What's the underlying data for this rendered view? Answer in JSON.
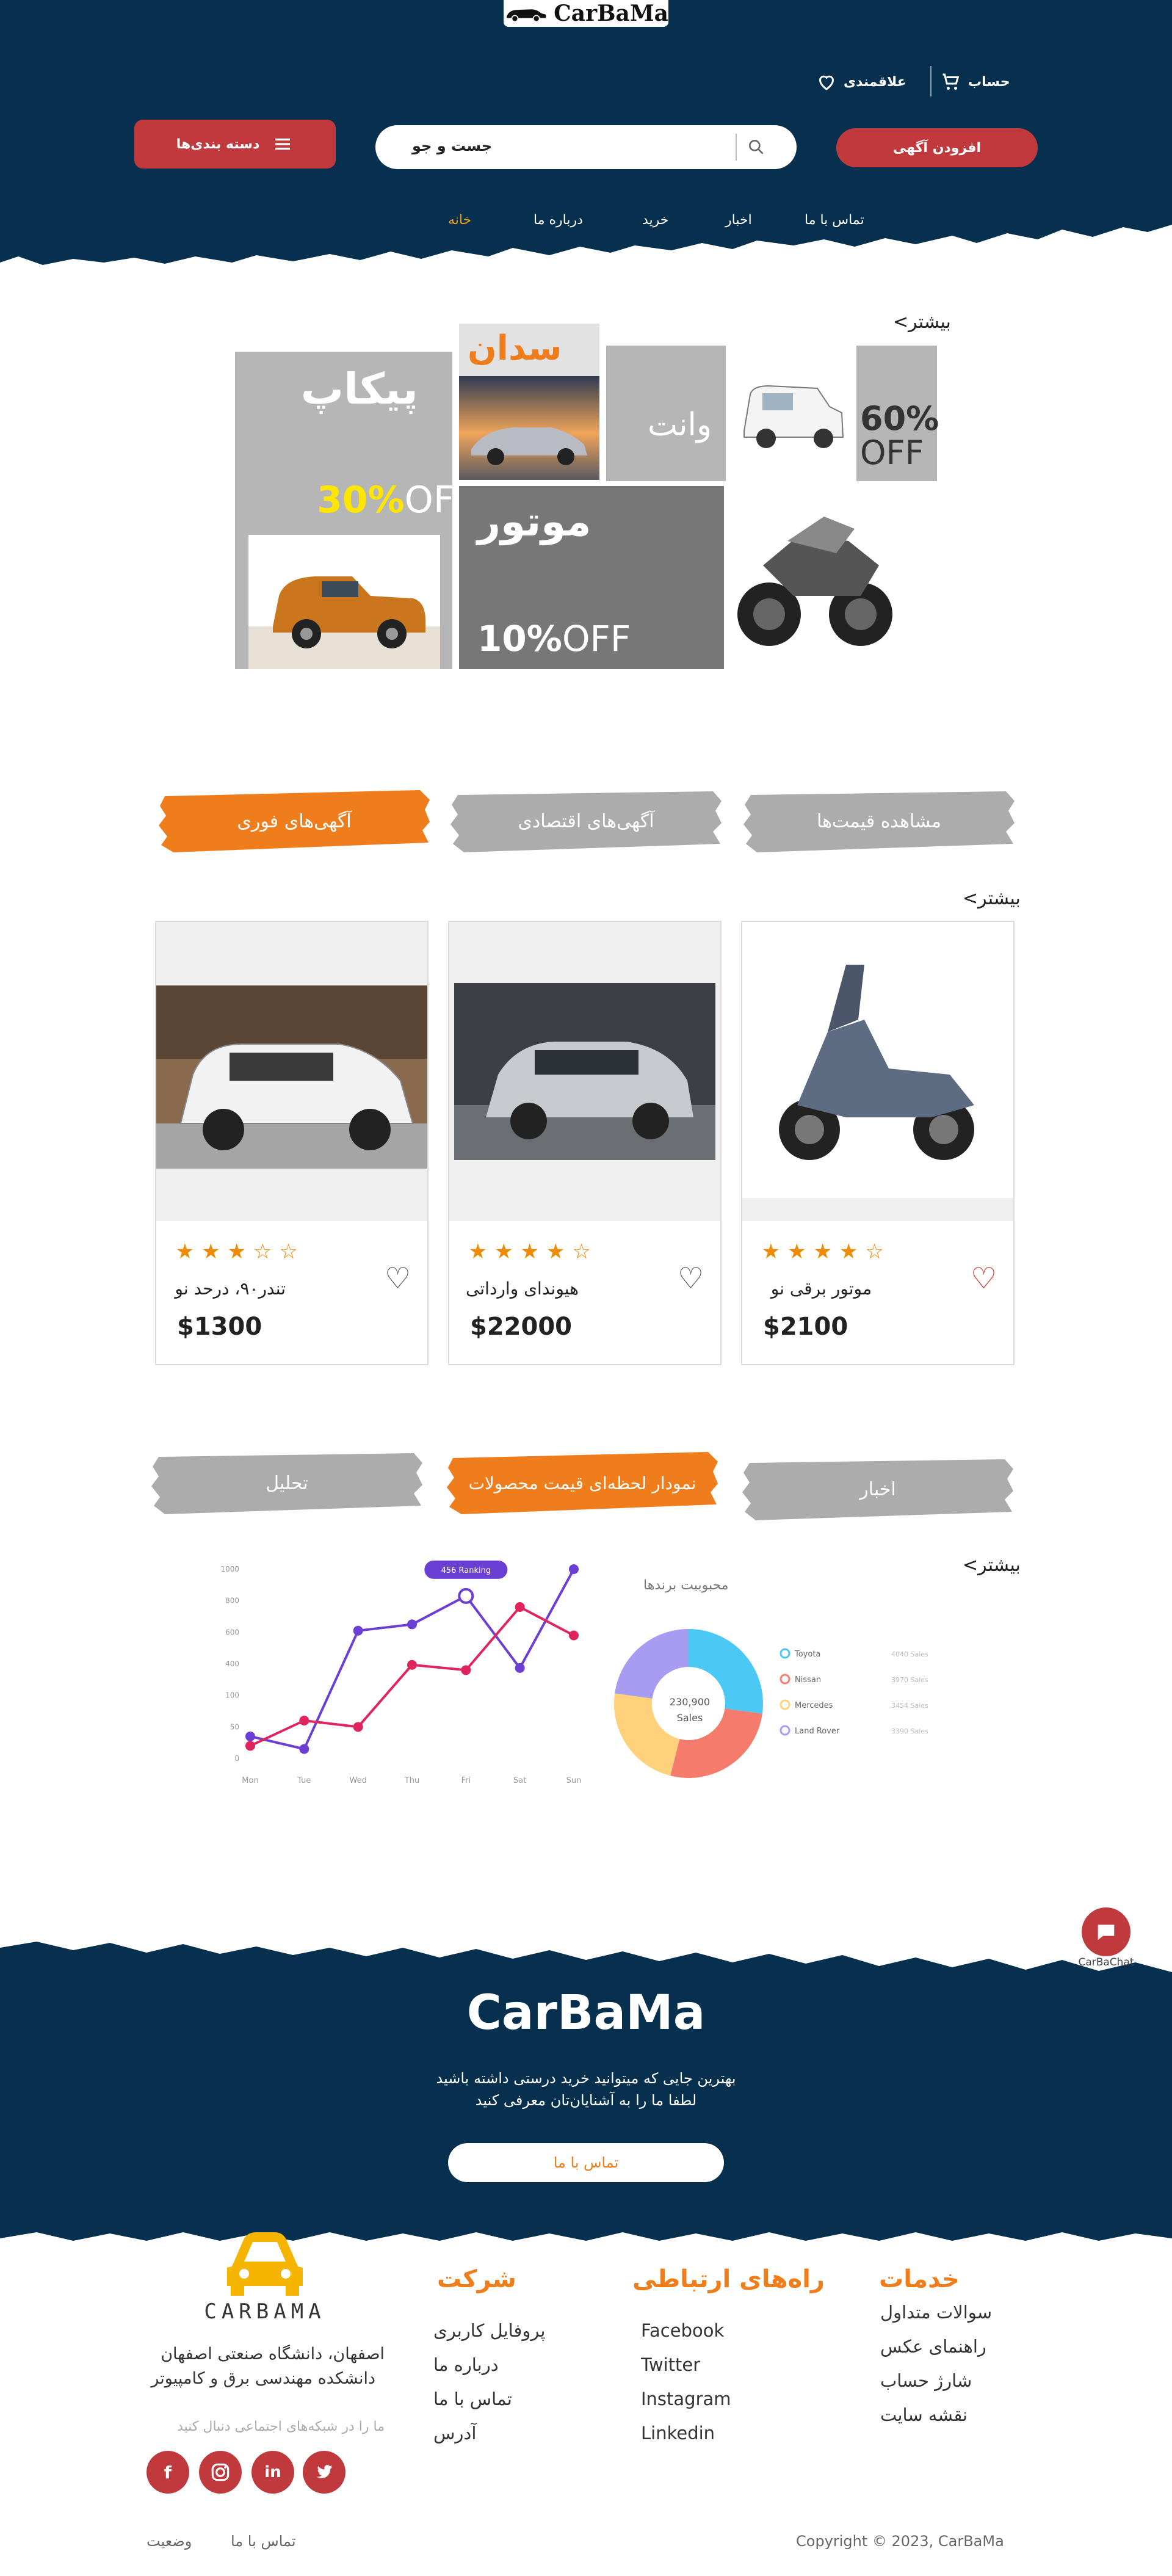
{
  "header": {
    "brand": "CarBaMa",
    "account_label": "حساب",
    "favorites_label": "علاقمندی",
    "add_ad_label": "افزودن آگهی",
    "search_placeholder": "جست و جو",
    "categories_label": "دسته بندی‌ها",
    "nav": [
      "خانه",
      "درباره ما",
      "خرید",
      "اخبار",
      "تماس با ما"
    ]
  },
  "banner": {
    "more": "<بیشتر",
    "pickup": {
      "title": "پیکاپ",
      "pct": "30%",
      "off": "OFF"
    },
    "sedan": {
      "title": "سدان"
    },
    "van": {
      "title": "وانت",
      "pct": "60%",
      "off": "OFF"
    },
    "motor": {
      "title": "موتور",
      "pct": "10%",
      "off": "OFF"
    }
  },
  "tabs1": [
    "آگهی‌های فوری",
    "آگهی‌های اقتصادی",
    "مشاهده قیمت‌ها"
  ],
  "products": {
    "more": "<بیشتر",
    "items": [
      {
        "name": "تندر۹۰، درحد نو",
        "price": "$1300",
        "rating": 3,
        "stars": "★★★☆☆",
        "favorite": false
      },
      {
        "name": "هیوندای وارداتی",
        "price": "$22000",
        "rating": 4,
        "stars": "★★★★☆",
        "favorite": false
      },
      {
        "name": "موتور برقی نو",
        "price": "$2100",
        "rating": 4,
        "stars": "★★★★☆",
        "favorite": true
      }
    ]
  },
  "tabs2": [
    "تحلیل",
    "نمودار لحظه‌ای قیمت محصولات",
    "اخبار"
  ],
  "analytics": {
    "more": "<بیشتر",
    "donut_title": "محبوبیت برندها",
    "donut_center_value": "230,900",
    "donut_center_label": "Sales"
  },
  "chart_data": [
    {
      "type": "line",
      "x": [
        "Mon",
        "Tue",
        "Wed",
        "Thu",
        "Fri",
        "Sat",
        "Sun"
      ],
      "yticks": [
        "1000",
        "800",
        "600",
        "400",
        "100",
        "50",
        "0"
      ],
      "series": [
        {
          "name": "",
          "color": "#6b3fd4",
          "values": [
            35,
            15,
            610,
            650,
            830,
            360,
            1000
          ]
        },
        {
          "name": "",
          "color": "#e0245e",
          "values": [
            20,
            60,
            50,
            390,
            340,
            760,
            580
          ]
        }
      ],
      "annotation": "456 Ranking",
      "annotation_point": "Fri"
    },
    {
      "type": "pie",
      "title": "محبوبیت برندها",
      "labels": [
        "Toyota",
        "Nissan",
        "Mercedes",
        "Land Rover"
      ],
      "values": [
        4040,
        3970,
        3454,
        3390
      ],
      "value_labels": [
        "4040 Sales",
        "3970 Sales",
        "3454 Sales",
        "3390 Sales"
      ],
      "colors": [
        "#4cc8f4",
        "#f57b6d",
        "#ffd17a",
        "#a79bf2"
      ]
    }
  ],
  "cta": {
    "brand": "CarBaMa",
    "line1": "بهترین جایی که میتوانید خرید درستی داشته باشید",
    "line2": "لطفا ما را به آشنایان‌تان معرفی کنید",
    "button": "تماس با ما",
    "chat_label": "CarBaChat"
  },
  "footer": {
    "logo_text": "CARBAMA",
    "address1": "اصفهان، دانشگاه صنعتی اصفهان",
    "address2": "دانشکده مهندسی برق و کامپیوتر",
    "follow": "ما را در شبکه‌های اجتماعی دنبال کنید",
    "company": {
      "title": "شرکت",
      "links": [
        "پروفایل کاربری",
        "درباره ما",
        "تماس با ما",
        "آدرس"
      ]
    },
    "contact": {
      "title": "راه‌های ارتباطی",
      "links": [
        "Facebook",
        "Twitter",
        "Instagram",
        "Linkedin"
      ]
    },
    "services": {
      "title": "خدمات",
      "links": [
        "سوالات متداول",
        "راهنمای عکس",
        "شارژ حساب",
        "نقشه سایت"
      ]
    },
    "bottom_links": [
      "تماس با ما",
      "وضعیت"
    ],
    "copyright": "Copyright © 2023, CarBaMa"
  }
}
